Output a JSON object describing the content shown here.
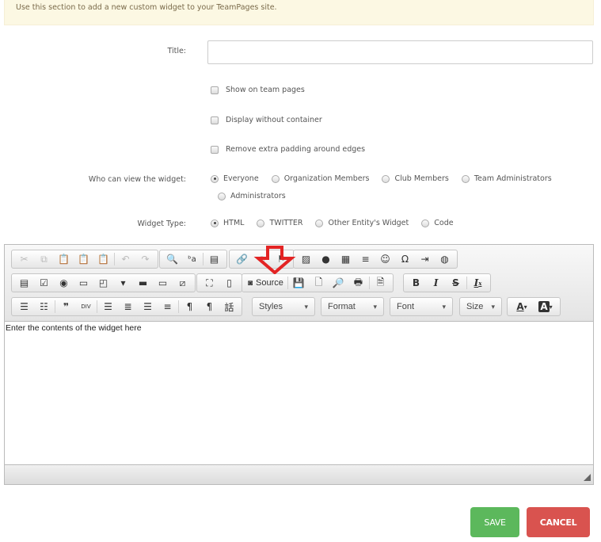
{
  "notice": "Use this section to add a new custom widget to your TeamPages site.",
  "form": {
    "title_label": "Title:",
    "title_value": "",
    "checkboxes": [
      {
        "label": "Show on team pages",
        "checked": false
      },
      {
        "label": "Display without container",
        "checked": false
      },
      {
        "label": "Remove extra padding around edges",
        "checked": false
      }
    ],
    "visibility_label": "Who can view the widget:",
    "visibility_options": [
      {
        "label": "Everyone",
        "selected": true
      },
      {
        "label": "Organization Members",
        "selected": false
      },
      {
        "label": "Club Members",
        "selected": false
      },
      {
        "label": "Team Administrators",
        "selected": false
      },
      {
        "label": "Administrators",
        "selected": false
      }
    ],
    "type_label": "Widget Type:",
    "type_options": [
      {
        "label": "HTML",
        "selected": true
      },
      {
        "label": "TWITTER",
        "selected": false
      },
      {
        "label": "Other Entity's Widget",
        "selected": false
      },
      {
        "label": "Code",
        "selected": false
      }
    ]
  },
  "editor": {
    "toolbar": {
      "row1": {
        "clipboard": [
          "cut-icon",
          "copy-icon",
          "paste-icon",
          "paste-text-icon",
          "paste-word-icon",
          "undo-icon",
          "redo-icon"
        ],
        "find": [
          "find-icon",
          "replace-icon",
          "select-all-icon"
        ],
        "links": [
          "link-icon",
          "unlink-icon",
          "anchor-icon"
        ],
        "insert": [
          "image-icon",
          "flash-icon",
          "table-icon",
          "horizontal-rule-icon",
          "smiley-icon",
          "special-char-icon",
          "page-break-icon",
          "iframe-icon"
        ]
      },
      "row2": {
        "forms": [
          "form-icon",
          "checkbox-icon",
          "radio-icon",
          "text-field-icon",
          "textarea-icon",
          "select-icon",
          "button-icon",
          "image-button-icon",
          "hidden-field-icon"
        ],
        "tools": [
          "maximize-icon",
          "show-blocks-icon"
        ],
        "source_label": "Source",
        "document": [
          "save-icon",
          "new-page-icon",
          "preview-icon",
          "print-icon",
          "templates-icon"
        ],
        "basic": [
          "B",
          "I",
          "S",
          "Ix"
        ]
      },
      "row3": {
        "paragraph": [
          "numbered-list-icon",
          "bulleted-list-icon",
          "blockquote-icon",
          "div-icon",
          "align-left-icon",
          "align-center-icon",
          "align-right-icon",
          "justify-icon",
          "ltr-icon",
          "rtl-icon",
          "language-icon"
        ],
        "styles": "Styles",
        "format": "Format",
        "font": "Font",
        "size": "Size",
        "text_color": "A",
        "bg_color": "A"
      }
    },
    "content": "Enter the contents of the widget here"
  },
  "annotation": {
    "color": "#e32424",
    "points_to": "Source"
  },
  "actions": {
    "save": "SAVE",
    "cancel": "CANCEL",
    "save_color": "#5cb85c",
    "cancel_color": "#d9534f"
  }
}
